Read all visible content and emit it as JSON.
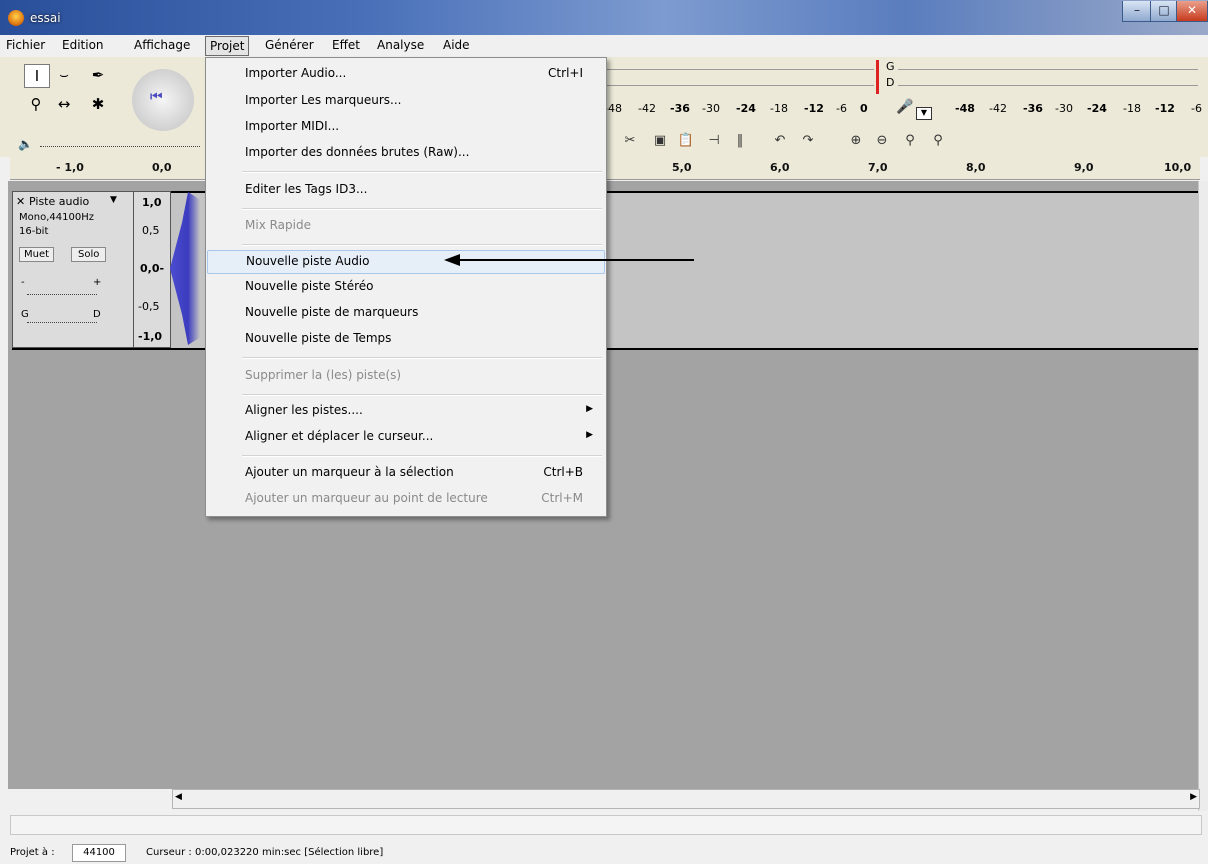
{
  "window": {
    "title": "essai"
  },
  "menubar": {
    "items": [
      "Fichier",
      "Edition",
      "Affichage",
      "Projet",
      "Générer",
      "Effet",
      "Analyse",
      "Aide"
    ]
  },
  "meters": {
    "left_scale": [
      "-48",
      "-42",
      "-36",
      "-30",
      "-24",
      "-18",
      "-12",
      "-6",
      "0"
    ],
    "right_scale": [
      "-48",
      "-42",
      "-36",
      "-30",
      "-24",
      "-18",
      "-12",
      "-6"
    ],
    "channel_g": "G",
    "channel_d": "D"
  },
  "ruler": {
    "ticks": [
      "- 1,0",
      "0,0",
      "5,0",
      "6,0",
      "7,0",
      "8,0",
      "9,0",
      "10,0"
    ]
  },
  "track": {
    "name": "Piste audio",
    "info1": "Mono,44100Hz",
    "info2": "16-bit",
    "mute": "Muet",
    "solo": "Solo",
    "pan_left": "G",
    "pan_right": "D",
    "gain_minus": "-",
    "gain_plus": "+",
    "scale": [
      "1,0",
      "0,5",
      "0,0-",
      "-0,5",
      "-1,0"
    ]
  },
  "projet_menu": {
    "items": [
      {
        "label": "Importer Audio...",
        "shortcut": "Ctrl+I"
      },
      {
        "label": "Importer Les marqueurs...",
        "shortcut": ""
      },
      {
        "label": "Importer MIDI...",
        "shortcut": ""
      },
      {
        "label": "Importer des données brutes (Raw)...",
        "shortcut": ""
      },
      {
        "label": "Editer les Tags ID3...",
        "shortcut": ""
      },
      {
        "label": "Mix Rapide",
        "shortcut": ""
      },
      {
        "label": "Nouvelle piste Audio",
        "shortcut": ""
      },
      {
        "label": "Nouvelle piste Stéréo",
        "shortcut": ""
      },
      {
        "label": "Nouvelle piste de marqueurs",
        "shortcut": ""
      },
      {
        "label": "Nouvelle piste de Temps",
        "shortcut": ""
      },
      {
        "label": "Supprimer la (les) piste(s)",
        "shortcut": ""
      },
      {
        "label": "Aligner les pistes....",
        "shortcut": ""
      },
      {
        "label": "Aligner et déplacer le curseur...",
        "shortcut": ""
      },
      {
        "label": "Ajouter un marqueur à  la sélection",
        "shortcut": "Ctrl+B"
      },
      {
        "label": "Ajouter un marqueur au point de lecture",
        "shortcut": "Ctrl+M"
      }
    ]
  },
  "status": {
    "rate_label": "Projet à :",
    "rate_value": "44100",
    "cursor_text": "Curseur : 0:00,023220 min:sec  [Sélection libre]"
  }
}
